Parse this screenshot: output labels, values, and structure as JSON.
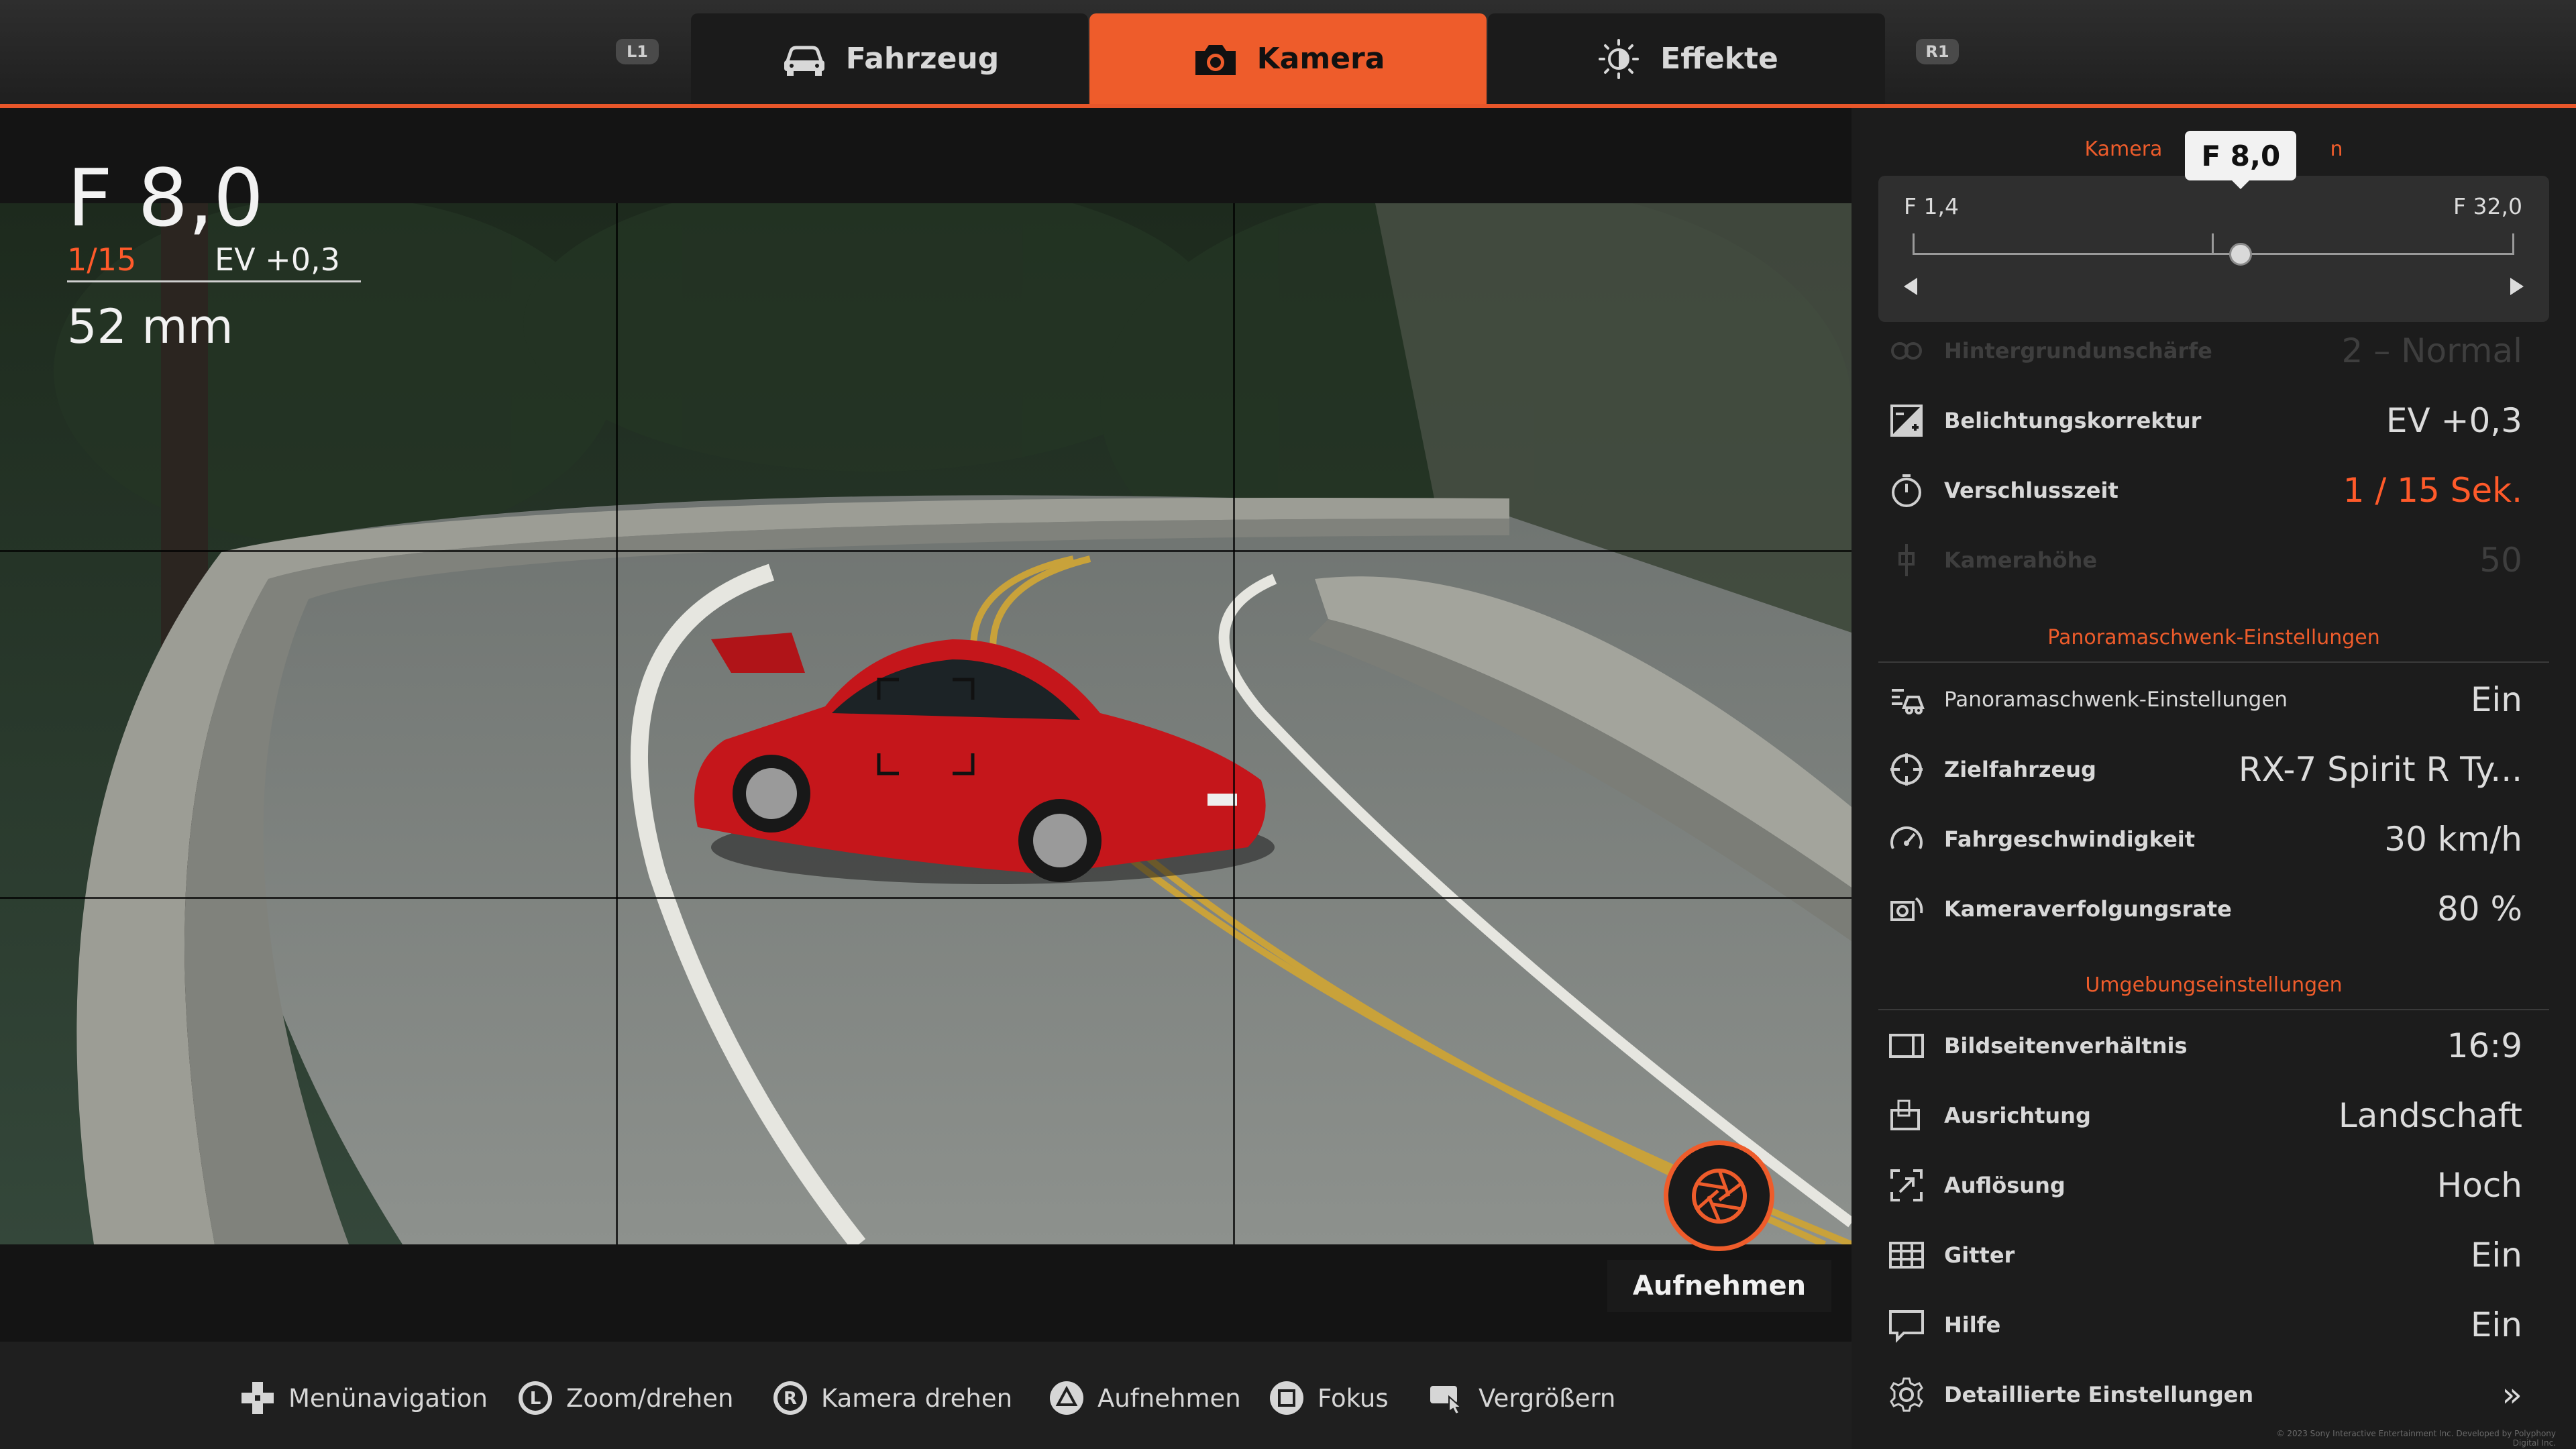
{
  "tabs": {
    "left_shoulder": "L1",
    "right_shoulder": "R1",
    "items": [
      {
        "label": "Fahrzeug",
        "icon": "car-icon",
        "active": false
      },
      {
        "label": "Kamera",
        "icon": "camera-icon",
        "active": true
      },
      {
        "label": "Effekte",
        "icon": "sun-icon",
        "active": false
      }
    ]
  },
  "overlay": {
    "aperture": "F 8,0",
    "shutter": "1/15",
    "ev": "EV +0,3",
    "focal_length": "52 mm"
  },
  "shutter_button": {
    "label": "Aufnehmen"
  },
  "hints": [
    {
      "icon": "dpad-icon",
      "label": "Menünavigation"
    },
    {
      "icon": "left-stick-icon",
      "glyph": "L",
      "label": "Zoom/drehen"
    },
    {
      "icon": "right-stick-icon",
      "glyph": "R",
      "label": "Kamera drehen"
    },
    {
      "icon": "triangle-button-icon",
      "label": "Aufnehmen"
    },
    {
      "icon": "square-button-icon",
      "label": "Fokus"
    },
    {
      "icon": "touchpad-icon",
      "label": "Vergrößern"
    }
  ],
  "panel": {
    "camera_section": {
      "title": "Kamera",
      "title_suffix": "n",
      "slider": {
        "min_label": "F 1,4",
        "max_label": "F 32,0",
        "current": "F 8,0",
        "position_fraction": 0.545
      }
    },
    "camera_rows": [
      {
        "icon": "bokeh-icon",
        "label": "Hintergrundunschärfe",
        "value": "2 – Normal",
        "disabled": true
      },
      {
        "icon": "exposure-icon",
        "label": "Belichtungskorrektur",
        "value": "EV +0,3",
        "disabled": false
      },
      {
        "icon": "timer-icon",
        "label": "Verschlusszeit",
        "value": "1 / 15 Sek.",
        "disabled": false,
        "highlight": true
      },
      {
        "icon": "camera-height-icon",
        "label": "Kamerahöhe",
        "value": "50",
        "disabled": true
      }
    ],
    "panning_section": {
      "title": "Panoramaschwenk-Einstellungen"
    },
    "panning_rows": [
      {
        "icon": "panning-icon",
        "label": "Panoramaschwenk-Einstellungen",
        "value": "Ein"
      },
      {
        "icon": "target-icon",
        "label": "Zielfahrzeug",
        "value": "RX-7 Spirit R Ty..."
      },
      {
        "icon": "speedometer-icon",
        "label": "Fahrgeschwindigkeit",
        "value": "30 km/h"
      },
      {
        "icon": "tracking-icon",
        "label": "Kameraverfolgungsrate",
        "value": "80 %"
      }
    ],
    "environment_section": {
      "title": "Umgebungseinstellungen"
    },
    "environment_rows": [
      {
        "icon": "aspect-ratio-icon",
        "label": "Bildseitenverhältnis",
        "value": "16:9"
      },
      {
        "icon": "orientation-icon",
        "label": "Ausrichtung",
        "value": "Landschaft"
      },
      {
        "icon": "resolution-icon",
        "label": "Auflösung",
        "value": "Hoch"
      },
      {
        "icon": "grid-icon",
        "label": "Gitter",
        "value": "Ein"
      },
      {
        "icon": "help-icon",
        "label": "Hilfe",
        "value": "Ein"
      }
    ],
    "detail_settings": {
      "icon": "gear-icon",
      "label": "Detaillierte Einstellungen",
      "chevron": "»"
    }
  },
  "copyright": "© 2023 Sony Interactive Entertainment Inc. Developed by Polyphony Digital Inc.",
  "colors": {
    "accent": "#ee5c2b",
    "highlight_text": "#ff5a2a",
    "panel_bg": "#1c1c1c"
  }
}
